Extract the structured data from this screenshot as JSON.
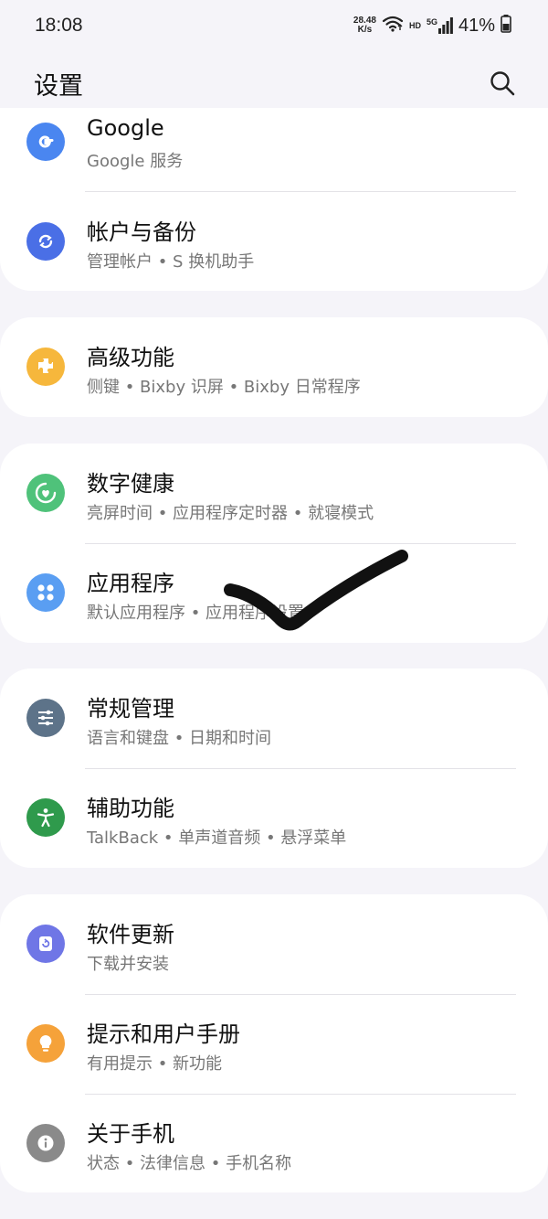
{
  "status_bar": {
    "time": "18:08",
    "net_speed_value": "28.48",
    "net_speed_unit": "K/s",
    "hd_label": "HD",
    "network_label": "5G",
    "battery": "41%"
  },
  "header": {
    "title": "设置"
  },
  "colors": {
    "google": "#4a86f0",
    "accounts": "#4a6fe6",
    "advanced": "#f6b73c",
    "wellbeing": "#4fc27a",
    "apps": "#5a9ef2",
    "general": "#5d7389",
    "accessibility": "#2f9a4c",
    "update": "#6f76e6",
    "tips": "#f5a23a",
    "about": "#8a8a8a"
  },
  "groups": [
    {
      "items": [
        {
          "title": "Google",
          "subtitle": "Google 服务",
          "icon": "google-icon"
        },
        {
          "title": "帐户与备份",
          "subtitle": "管理帐户 • S 换机助手",
          "icon": "sync-icon"
        }
      ]
    },
    {
      "items": [
        {
          "title": "高级功能",
          "subtitle": "侧键 • Bixby 识屏 • Bixby 日常程序",
          "icon": "puzzle-icon"
        }
      ]
    },
    {
      "items": [
        {
          "title": "数字健康",
          "subtitle": "亮屏时间 • 应用程序定时器 • 就寝模式",
          "icon": "heart-ring-icon"
        },
        {
          "title": "应用程序",
          "subtitle": "默认应用程序 • 应用程序设置",
          "icon": "apps-grid-icon"
        }
      ]
    },
    {
      "items": [
        {
          "title": "常规管理",
          "subtitle": "语言和键盘 • 日期和时间",
          "icon": "sliders-icon"
        },
        {
          "title": "辅助功能",
          "subtitle": "TalkBack • 单声道音频 • 悬浮菜单",
          "icon": "accessibility-icon"
        }
      ]
    },
    {
      "items": [
        {
          "title": "软件更新",
          "subtitle": "下载并安装",
          "icon": "update-icon"
        },
        {
          "title": "提示和用户手册",
          "subtitle": "有用提示 • 新功能",
          "icon": "lightbulb-icon"
        },
        {
          "title": "关于手机",
          "subtitle": "状态 • 法律信息 • 手机名称",
          "icon": "info-icon"
        }
      ]
    }
  ]
}
